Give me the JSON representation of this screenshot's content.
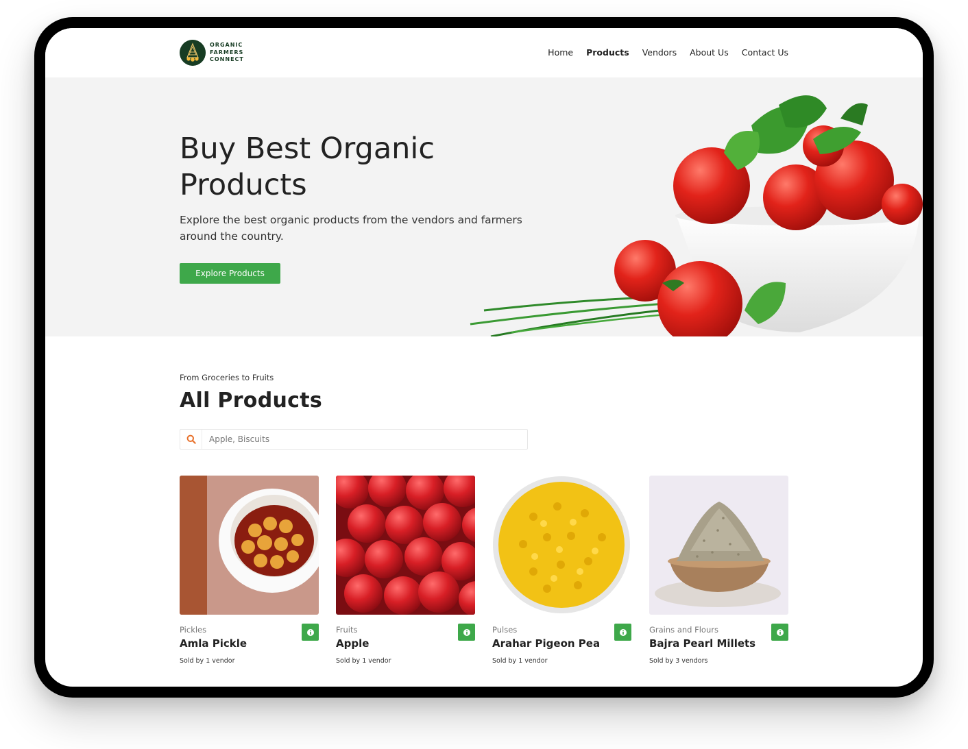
{
  "brand": {
    "line1": "ORGANIC",
    "line2": "FARMERS",
    "line3": "CONNECT"
  },
  "nav": [
    {
      "label": "Home",
      "active": false
    },
    {
      "label": "Products",
      "active": true
    },
    {
      "label": "Vendors",
      "active": false
    },
    {
      "label": "About Us",
      "active": false
    },
    {
      "label": "Contact Us",
      "active": false
    }
  ],
  "hero": {
    "title": "Buy Best Organic Products",
    "subtitle": "Explore the best organic products from the vendors and farmers around the country.",
    "cta": "Explore Products"
  },
  "products_section": {
    "kicker": "From Groceries to Fruits",
    "title": "All Products",
    "search_placeholder": "Apple, Biscuits"
  },
  "products": [
    {
      "category": "Pickles",
      "name": "Amla Pickle",
      "sold": "Sold by 1 vendor"
    },
    {
      "category": "Fruits",
      "name": "Apple",
      "sold": "Sold by 1 vendor"
    },
    {
      "category": "Pulses",
      "name": "Arahar Pigeon Pea",
      "sold": "Sold by 1 vendor"
    },
    {
      "category": "Grains and Flours",
      "name": "Bajra Pearl Millets",
      "sold": "Sold by 3 vendors"
    }
  ],
  "icons": {
    "search": "search-icon",
    "info": "info-icon",
    "logo": "logo-emblem-icon"
  },
  "colors": {
    "accent": "#3ea84a",
    "brand": "#173c23",
    "search_icon": "#e8702a",
    "hero_bg": "#f3f3f3"
  }
}
